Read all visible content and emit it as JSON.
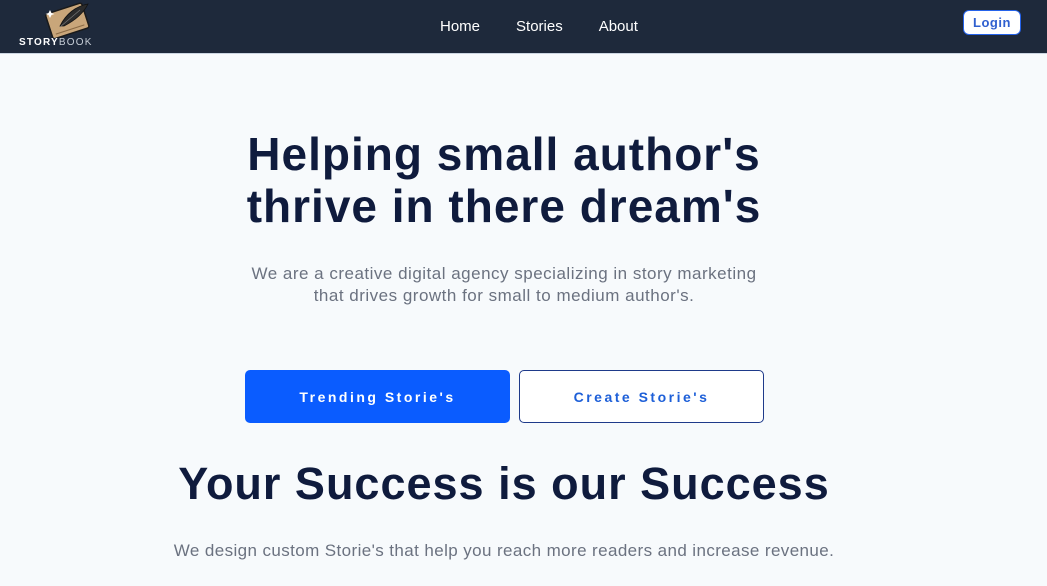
{
  "brand": {
    "name_part1": "STORY",
    "name_part2": "BOOK",
    "logo_icon": "book-quill-icon"
  },
  "nav": {
    "items": [
      {
        "label": "Home"
      },
      {
        "label": "Stories"
      },
      {
        "label": "About"
      }
    ],
    "login_label": "Login"
  },
  "hero": {
    "title_line1": "Helping small author's",
    "title_line2": "thrive in there dream's",
    "subtitle_line1": "We are a creative digital agency specializing in story marketing",
    "subtitle_line2": "that drives growth for small to medium author's.",
    "primary_button": "Trending Storie's",
    "secondary_button": "Create Storie's"
  },
  "success": {
    "title": "Your Success is our Success",
    "subtitle": "We design custom Storie's that help you reach more readers and increase revenue."
  },
  "colors": {
    "header_bg": "#1e293b",
    "page_bg": "#f7fafc",
    "heading": "#0f1b3d",
    "primary": "#0a5cff",
    "muted_text": "#6b7280"
  }
}
